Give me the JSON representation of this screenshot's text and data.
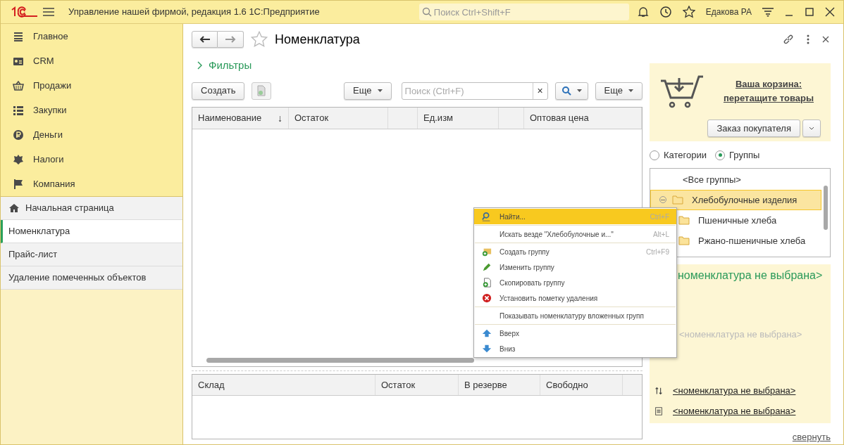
{
  "app": {
    "title": "Управление нашей фирмой, редакция 1.6 1С:Предприятие",
    "search_placeholder": "Поиск Ctrl+Shift+F",
    "user": "Едакова РА"
  },
  "sidebar": {
    "sections": [
      {
        "label": "Главное",
        "kind": "main"
      },
      {
        "label": "CRM",
        "kind": "crm"
      },
      {
        "label": "Продажи",
        "kind": "sales"
      },
      {
        "label": "Закупки",
        "kind": "purchases"
      },
      {
        "label": "Деньги",
        "kind": "money"
      },
      {
        "label": "Налоги",
        "kind": "taxes"
      },
      {
        "label": "Компания",
        "kind": "company"
      }
    ],
    "pages": [
      {
        "label": "Начальная страница",
        "kind": "home",
        "selected": false
      },
      {
        "label": "Номенклатура",
        "kind": "page",
        "selected": true
      },
      {
        "label": "Прайс-лист",
        "kind": "page",
        "selected": false
      },
      {
        "label": "Удаление помеченных объектов",
        "kind": "page",
        "selected": false
      }
    ]
  },
  "form": {
    "title": "Номенклатура",
    "filters": "Фильтры",
    "create": "Создать",
    "more": "Еще",
    "search_placeholder": "Поиск (Ctrl+F)",
    "clear": "×",
    "more_right": "Еще",
    "columns": [
      {
        "label": "Наименование",
        "sort_mark": "↓"
      },
      {
        "label": "Остаток"
      },
      {},
      {
        "label": "Ед.изм"
      },
      {},
      {
        "label": "Оптовая цена"
      }
    ],
    "stock_columns": [
      "Склад",
      "Остаток",
      "В резерве",
      "Свободно"
    ]
  },
  "cart": {
    "link": "Ваша корзина: перетащите товары",
    "order_button": "Заказ покупателя"
  },
  "view_modes": [
    {
      "label": "Категории",
      "selected": false
    },
    {
      "label": "Группы",
      "selected": true
    }
  ],
  "groups": [
    {
      "label": "<Все группы>",
      "kind": "all",
      "selected": false
    },
    {
      "label": "Хлебобулочные изделия",
      "kind": "folder",
      "selected": true,
      "expanded": true,
      "children": [
        {
          "label": "Пшеничные хлеба",
          "kind": "folder",
          "selected": false
        },
        {
          "label": "Ржано-пшеничные хлеба",
          "kind": "folder",
          "selected": false
        }
      ]
    }
  ],
  "info": {
    "name": "номенклатура не выбрана>",
    "detail": "<номенклатура не выбрана>",
    "links": [
      {
        "label": "<номенклатура не выбрана>",
        "kind": "arrows"
      },
      {
        "label": "<номенклатура не выбрана>",
        "kind": "document"
      }
    ],
    "collapse": "свернуть"
  },
  "context_menu": [
    {
      "kind": "find",
      "label": "Найти...",
      "shortcut": "Ctrl+F",
      "selected": true
    },
    {
      "kind": "separator"
    },
    {
      "kind": "plain",
      "label": "Искать везде \"Хлебобулочные и...\"",
      "shortcut": "Alt+L",
      "selected": false
    },
    {
      "kind": "separator"
    },
    {
      "kind": "create",
      "label": "Создать группу",
      "shortcut": "Ctrl+F9",
      "selected": false
    },
    {
      "kind": "edit",
      "label": "Изменить группу",
      "selected": false
    },
    {
      "kind": "copy",
      "label": "Скопировать группу",
      "selected": false
    },
    {
      "kind": "delete",
      "label": "Установить пометку удаления",
      "selected": false
    },
    {
      "kind": "separator"
    },
    {
      "kind": "plain",
      "label": "Показывать номенклатуру вложенных групп",
      "selected": false
    },
    {
      "kind": "separator"
    },
    {
      "kind": "up",
      "label": "Вверх",
      "selected": false
    },
    {
      "kind": "down",
      "label": "Вниз",
      "selected": false
    }
  ]
}
